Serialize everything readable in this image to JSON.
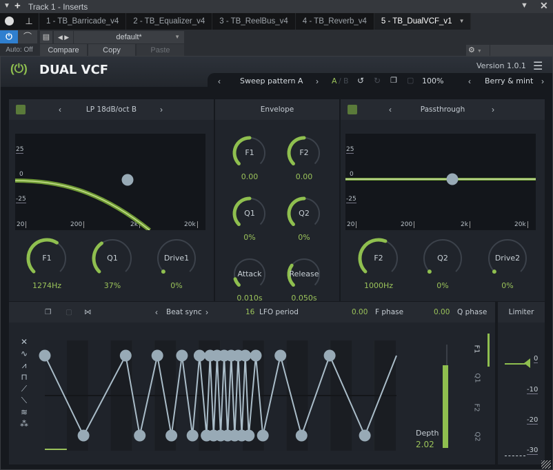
{
  "host": {
    "window_title": "Track 1 - Inserts",
    "tabs": [
      "1 - TB_Barricade_v4",
      "2 - TB_Equalizer_v4",
      "3 - TB_ReelBus_v4",
      "4 - TB_Reverb_v4",
      "5 - TB_DualVCF_v1"
    ],
    "active_tab": 4,
    "preset": "default*",
    "auto": "Auto: Off",
    "compare": "Compare",
    "copy": "Copy",
    "paste": "Paste"
  },
  "plugin": {
    "title": "DUAL VCF",
    "version": "Version 1.0.1",
    "preset_name": "Sweep pattern A",
    "ab_a": "A",
    "ab_sep": "/",
    "ab_b": "B",
    "zoom": "100%",
    "skin": "Berry & mint",
    "accent": "#9bc35a",
    "filter1": {
      "type": "LP 18dB/oct B",
      "graph_y_labels": [
        "25",
        "0",
        "-25"
      ],
      "graph_x_labels": [
        "20",
        "200",
        "2k",
        "20k"
      ],
      "knobs": [
        {
          "name": "F1",
          "value": "1274Hz",
          "level": 0.62
        },
        {
          "name": "Q1",
          "value": "37%",
          "level": 0.37
        },
        {
          "name": "Drive1",
          "value": "0%",
          "level": 0
        }
      ]
    },
    "envelope": {
      "title": "Envelope",
      "knobs": [
        {
          "name": "F1",
          "value": "0.00",
          "level": 0.5
        },
        {
          "name": "F2",
          "value": "0.00",
          "level": 0.5
        },
        {
          "name": "Q1",
          "value": "0%",
          "level": 0.5
        },
        {
          "name": "Q2",
          "value": "0%",
          "level": 0.5
        },
        {
          "name": "Attack",
          "value": "0.010s",
          "level": 0.1
        },
        {
          "name": "Release",
          "value": "0.050s",
          "level": 0.3
        }
      ]
    },
    "filter2": {
      "type": "Passthrough",
      "graph_y_labels": [
        "25",
        "0",
        "-25"
      ],
      "graph_x_labels": [
        "20",
        "200",
        "2k",
        "20k"
      ],
      "knobs": [
        {
          "name": "F2",
          "value": "1000Hz",
          "level": 0.58
        },
        {
          "name": "Q2",
          "value": "0%",
          "level": 0
        },
        {
          "name": "Drive2",
          "value": "0%",
          "level": 0
        }
      ]
    },
    "lfo": {
      "sync": "Beat sync",
      "period_value": "16",
      "period_label": "LFO period",
      "fphase_value": "0.00",
      "fphase_label": "F phase",
      "qphase_value": "0.00",
      "qphase_label": "Q phase",
      "shapes": [
        "clear",
        "sine",
        "saw",
        "square",
        "ramp-up",
        "ramp-down",
        "noise",
        "random"
      ],
      "points": [
        0.0,
        1,
        0.11,
        0,
        0.23,
        1,
        0.27,
        0,
        0.32,
        1,
        0.36,
        0,
        0.39,
        1,
        0.42,
        0,
        0.44,
        1,
        0.46,
        0,
        0.47,
        1,
        0.48,
        0,
        0.49,
        1,
        0.5,
        0,
        0.51,
        1,
        0.52,
        0,
        0.53,
        1,
        0.54,
        0,
        0.55,
        1,
        0.56,
        0,
        0.57,
        1,
        0.58,
        0,
        0.6,
        1,
        0.62,
        0,
        0.67,
        1,
        0.73,
        0,
        0.81,
        1,
        0.91,
        0
      ],
      "depth_label": "Depth",
      "depth_value": "2.02",
      "depth_level": 0.8,
      "targets": [
        "F1",
        "Q1",
        "F2",
        "Q2"
      ],
      "active_target": "F1"
    },
    "limiter": {
      "title": "Limiter",
      "scale": [
        "0",
        "-10",
        "-20",
        "-30"
      ]
    }
  }
}
